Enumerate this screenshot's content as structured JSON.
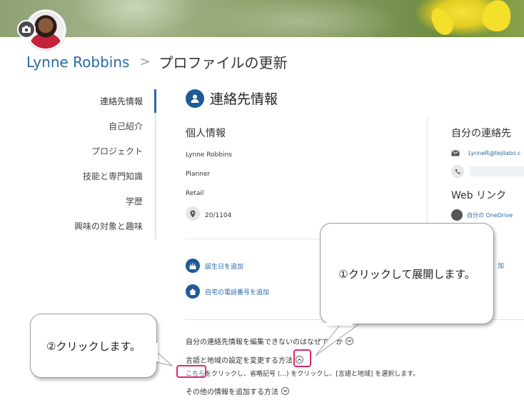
{
  "header": {
    "user_name": "Lynne Robbins",
    "separator": ">",
    "page_title": "プロファイルの更新"
  },
  "sidebar": {
    "items": [
      {
        "label": "連絡先情報",
        "active": true
      },
      {
        "label": "自己紹介"
      },
      {
        "label": "プロジェクト"
      },
      {
        "label": "技能と専門知識"
      },
      {
        "label": "学歴"
      },
      {
        "label": "興味の対象と趣味"
      }
    ]
  },
  "section": {
    "title": "連絡先情報",
    "personal": {
      "heading": "個人情報",
      "name": "Lynne Robbins",
      "job_title": "Planner",
      "department": "Retail",
      "office": "20/1104"
    },
    "contact": {
      "heading": "自分の連絡先",
      "email": "LynneR@tejilabo.c",
      "web_heading": "Web リンク",
      "onedrive": "自分の OneDrive",
      "partial_link": "加"
    },
    "actions": {
      "add_birthday": "誕生日を追加",
      "add_home_phone": "自宅の電話番号を追加"
    },
    "faq": {
      "q1": "自分の連絡先情報を編集できないのはなぜですか",
      "q2": "言語と地域の設定を変更する方法",
      "answer_link": "こちら",
      "answer_rest": "をクリックし、省略記号 (...) をクリックし、[言語と地域] を選択します。",
      "q3": "その他の情報を追加する方法"
    }
  },
  "callouts": {
    "step1": "①クリックして展開します。",
    "step2": "②クリックします。"
  },
  "colors": {
    "accent_blue": "#2a6aa6",
    "icon_blue": "#1e5a96",
    "highlight_pink": "#e0266f"
  }
}
